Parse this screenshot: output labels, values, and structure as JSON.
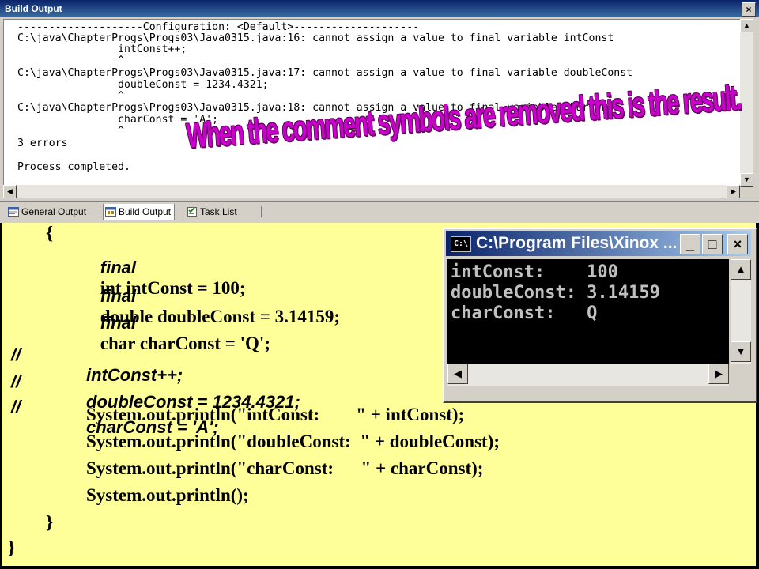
{
  "build_window": {
    "title": "Build Output",
    "close": "×",
    "output_lines": [
      "--------------------Configuration: <Default>--------------------",
      "C:\\java\\ChapterProgs\\Progs03\\Java0315.java:16: cannot assign a value to final variable intConst",
      "                intConst++;",
      "                ^",
      "C:\\java\\ChapterProgs\\Progs03\\Java0315.java:17: cannot assign a value to final variable doubleConst",
      "                doubleConst = 1234.4321;",
      "                ^",
      "C:\\java\\ChapterProgs\\Progs03\\Java0315.java:18: cannot assign a value to final variable charConst",
      "                charConst = 'A';",
      "                ^",
      "3 errors",
      "",
      "Process completed."
    ],
    "scroll": {
      "up": "▲",
      "down": "▼",
      "left": "◀",
      "right": "▶"
    },
    "tabs": [
      {
        "label": "General Output",
        "icon": "general-output-icon"
      },
      {
        "label": "Build Output",
        "icon": "build-output-icon"
      },
      {
        "label": "Task List",
        "icon": "task-list-icon"
      }
    ]
  },
  "caption": "When the comment symbols are removed this is the result.",
  "code": {
    "open_brace": "{",
    "final_kw": "final",
    "decl_1": "int intConst = 100;",
    "decl_2": "double doubleConst = 3.14159;",
    "decl_3": "char charConst = 'Q';",
    "comment_mark": "//",
    "commented_1": "intConst++;",
    "commented_2": "doubleConst = 1234.4321;",
    "commented_3": "charConst = 'A';",
    "print_1": "System.out.println(\"intConst:        \" + intConst);",
    "print_2": "System.out.println(\"doubleConst:  \" + doubleConst);",
    "print_3": "System.out.println(\"charConst:      \" + charConst);",
    "print_4": "System.out.println();",
    "close_inner": "}",
    "close_outer": "}"
  },
  "console": {
    "title": "C:\\Program Files\\Xinox ...",
    "icon": "C:\\",
    "min": "_",
    "max": "□",
    "close": "×",
    "lines": [
      "intConst:    100",
      "doubleConst: 3.14159",
      "charConst:   Q"
    ],
    "scroll": {
      "up": "▲",
      "down": "▼",
      "left": "◀",
      "right": "▶"
    }
  }
}
